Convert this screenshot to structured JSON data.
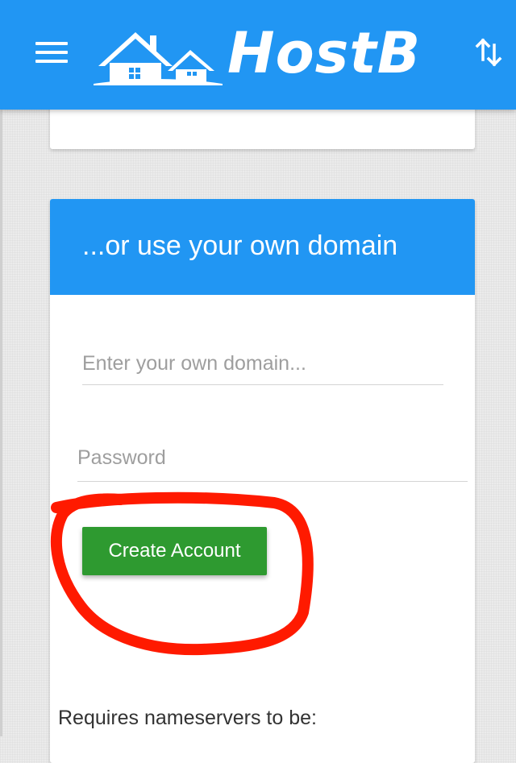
{
  "topbar": {
    "brand": "HostB",
    "menu_icon": "hamburger-menu-icon",
    "sort_icon": "sort-arrows-icon",
    "color": "#2196f3"
  },
  "domain_card": {
    "title": "...or use your own domain",
    "domain_field": {
      "value": "",
      "placeholder": "Enter your own domain..."
    },
    "password_field": {
      "value": "",
      "placeholder": "Password"
    },
    "create_button_label": "Create Account",
    "create_button_color": "#2e9a30",
    "nameservers_text": "Requires nameservers to be:"
  },
  "annotation": {
    "shape": "hand-drawn circle around Create Account button",
    "color": "#ff1a00"
  }
}
